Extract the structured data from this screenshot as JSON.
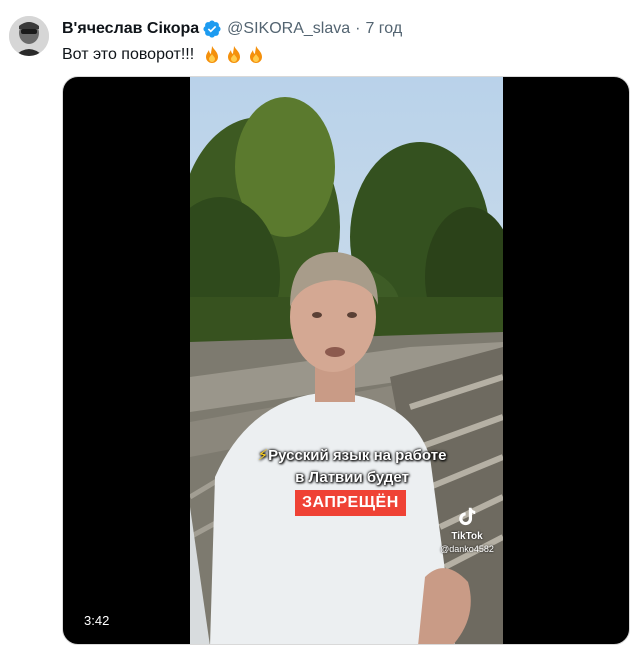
{
  "tweet": {
    "display_name": "В'ячеслав Сікора",
    "handle": "@SIKORA_slava",
    "separator": "·",
    "time": "7 год",
    "text": "Вот это поворот!!!",
    "emoji_icons": [
      "fire-icon",
      "fire-icon",
      "fire-icon"
    ]
  },
  "video": {
    "caption_line1": "Русский язык на работе",
    "caption_line2": "в Латвии будет",
    "ban_label": "ЗАПРЕЩЁН",
    "watermark_brand": "TikTok",
    "watermark_user": "@danko4582",
    "duration": "3:42"
  },
  "colors": {
    "verified": "#1d9bf0",
    "ban_background": "#ef4235",
    "secondary_text": "#536471"
  }
}
